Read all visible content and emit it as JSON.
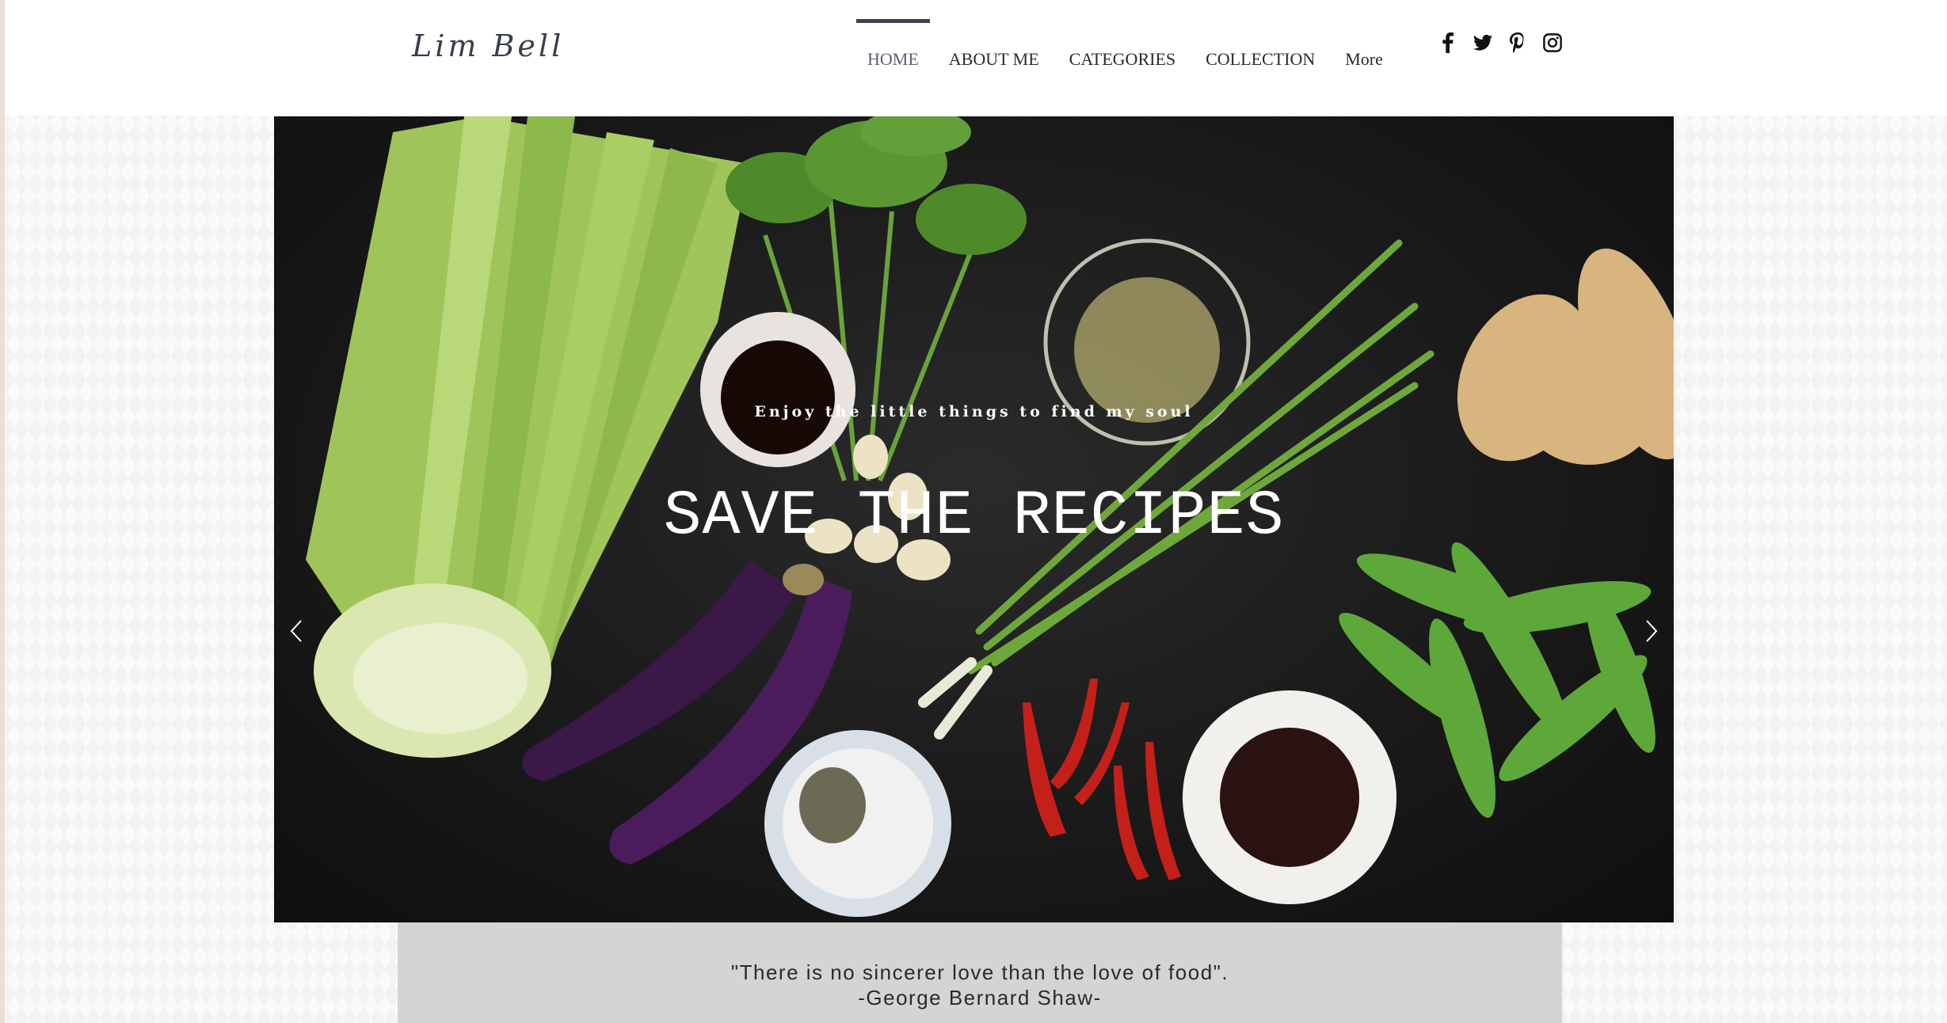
{
  "site": {
    "logo": "Lim Bell"
  },
  "nav": {
    "items": [
      {
        "label": "HOME",
        "active": true
      },
      {
        "label": "ABOUT ME",
        "active": false
      },
      {
        "label": "CATEGORIES",
        "active": false
      },
      {
        "label": "COLLECTION",
        "active": false
      },
      {
        "label": "More",
        "active": false
      }
    ]
  },
  "social": {
    "icons": [
      "facebook-icon",
      "twitter-icon",
      "pinterest-icon",
      "instagram-icon"
    ]
  },
  "hero": {
    "tagline": "Enjoy the little things to find my soul",
    "title": "SAVE THE RECIPES",
    "prev_icon": "chevron-left-icon",
    "next_icon": "chevron-right-icon"
  },
  "quote": {
    "text": "\"There is no sincerer love than the love of food\".",
    "author": "-George Bernard Shaw-"
  },
  "colors": {
    "accent": "#3d4354",
    "nav_text": "#2b2b2b",
    "quote_bg": "#d4d4d4"
  }
}
